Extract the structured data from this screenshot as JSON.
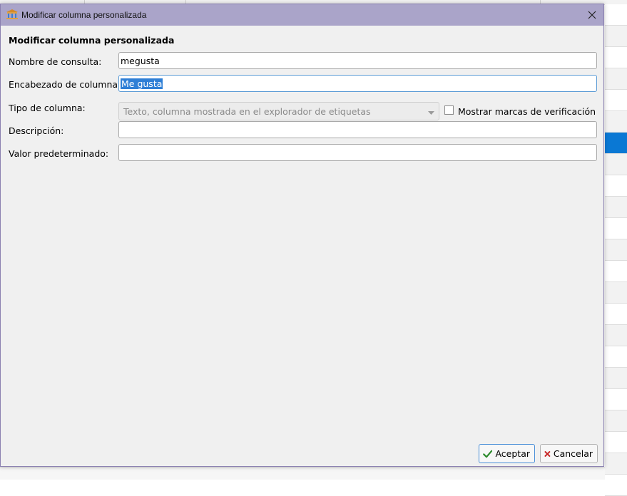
{
  "window": {
    "title": "Modificar columna personalizada",
    "icon": "library-icon"
  },
  "form": {
    "heading": "Modificar columna personalizada",
    "lookup_name_label": "Nombre de consulta:",
    "lookup_name_value": "megusta",
    "column_heading_label": "Encabezado de columna:",
    "column_heading_value": "Me gusta",
    "column_type_label": "Tipo de columna:",
    "column_type_value": "Texto, columna mostrada en el explorador de etiquetas",
    "show_checkmarks_label": "Mostrar marcas de verificación",
    "show_checkmarks_checked": false,
    "description_label": "Descripción:",
    "description_value": "",
    "default_value_label": "Valor predeterminado:",
    "default_value_value": ""
  },
  "buttons": {
    "ok_label": "Aceptar",
    "cancel_label": "Cancelar"
  },
  "colors": {
    "titlebar": "#aaa4c9",
    "selection": "#2f7fd6",
    "ok_icon": "#2e8b2e",
    "cancel_icon": "#c62020"
  }
}
